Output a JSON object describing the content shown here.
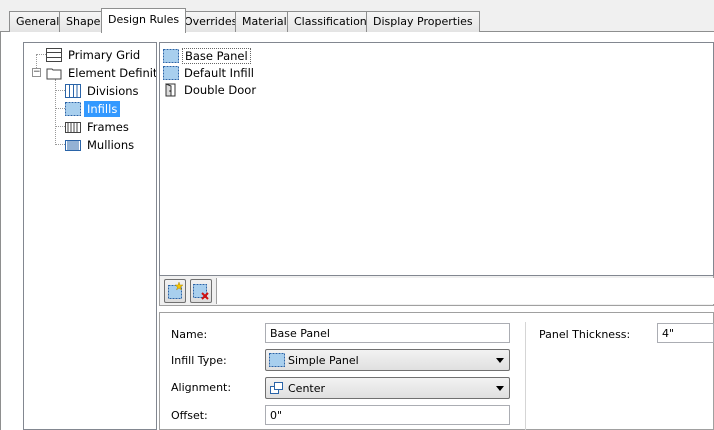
{
  "tabs": [
    {
      "label": "General"
    },
    {
      "label": "Shape"
    },
    {
      "label": "Design Rules"
    },
    {
      "label": "Overrides"
    },
    {
      "label": "Materials"
    },
    {
      "label": "Classifications"
    },
    {
      "label": "Display Properties"
    }
  ],
  "active_tab": "Design Rules",
  "tree": {
    "items": [
      {
        "label": "Primary Grid",
        "icon": "grid-icon"
      },
      {
        "label": "Element Definiti",
        "icon": "folder-icon",
        "expander": "−"
      },
      {
        "label": "Divisions",
        "icon": "divisions-icon"
      },
      {
        "label": "Infills",
        "icon": "infill-icon",
        "selected": true
      },
      {
        "label": "Frames",
        "icon": "frames-icon"
      },
      {
        "label": "Mullions",
        "icon": "mullions-icon"
      }
    ]
  },
  "list": {
    "items": [
      {
        "label": "Base Panel",
        "icon": "infill-icon",
        "selected": true
      },
      {
        "label": "Default Infill",
        "icon": "infill-icon"
      },
      {
        "label": "Double Door",
        "icon": "door-icon"
      }
    ]
  },
  "toolbar": {
    "add_tooltip": "New Infill",
    "delete_tooltip": "Remove Infill"
  },
  "properties": {
    "name_label": "Name:",
    "name_value": "Base Panel",
    "infill_type_label": "Infill Type:",
    "infill_type_value": "Simple Panel",
    "alignment_label": "Alignment:",
    "alignment_value": "Center",
    "offset_label": "Offset:",
    "offset_value": "0\"",
    "panel_thickness_label": "Panel Thickness:",
    "panel_thickness_value": "4\""
  },
  "colors": {
    "selection": "#3399ff",
    "infill_fill": "#a8cfee"
  }
}
